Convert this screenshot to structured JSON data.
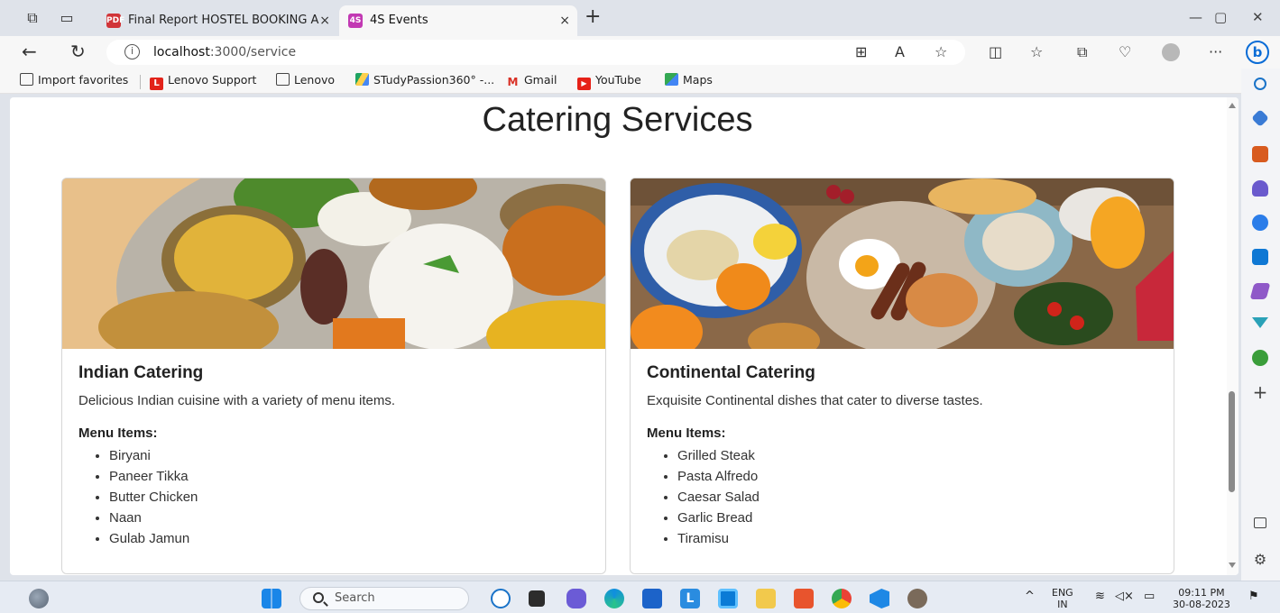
{
  "browser": {
    "tabs": [
      {
        "title": "Final Report HOSTEL BOOKING A",
        "favicon": "pdf-icon",
        "active": false
      },
      {
        "title": "4S Events",
        "favicon_text": "4S",
        "active": true
      }
    ],
    "close_glyph": "×",
    "new_tab_glyph": "+",
    "address": {
      "host": "localhost",
      "path": ":3000/service"
    },
    "favorites": [
      {
        "label": "Import favorites",
        "icon": "import-icon"
      },
      {
        "label": "Lenovo Support",
        "icon": "lenovo-L-icon"
      },
      {
        "label": "Lenovo",
        "icon": "page-icon"
      },
      {
        "label": "STudyPassion360° -...",
        "icon": "drive-icon"
      },
      {
        "label": "Gmail",
        "icon": "gmail-icon"
      },
      {
        "label": "YouTube",
        "icon": "youtube-icon"
      },
      {
        "label": "Maps",
        "icon": "maps-icon"
      }
    ]
  },
  "page": {
    "heading": "Catering Services",
    "cards": [
      {
        "title": "Indian Catering",
        "description": "Delicious Indian cuisine with a variety of menu items.",
        "menu_label": "Menu Items:",
        "items": [
          "Biryani",
          "Paneer Tikka",
          "Butter Chicken",
          "Naan",
          "Gulab Jamun"
        ]
      },
      {
        "title": "Continental Catering",
        "description": "Exquisite Continental dishes that cater to diverse tastes.",
        "menu_label": "Menu Items:",
        "items": [
          "Grilled Steak",
          "Pasta Alfredo",
          "Caesar Salad",
          "Garlic Bread",
          "Tiramisu"
        ]
      }
    ]
  },
  "taskbar": {
    "search_placeholder": "Search",
    "lang_line1": "ENG",
    "lang_line2": "IN",
    "time": "09:11 PM",
    "date": "30-08-2023"
  },
  "colors": {
    "accent_blue": "#0067c0",
    "youtube_red": "#e62117",
    "lenovo_red": "#e2231a"
  }
}
